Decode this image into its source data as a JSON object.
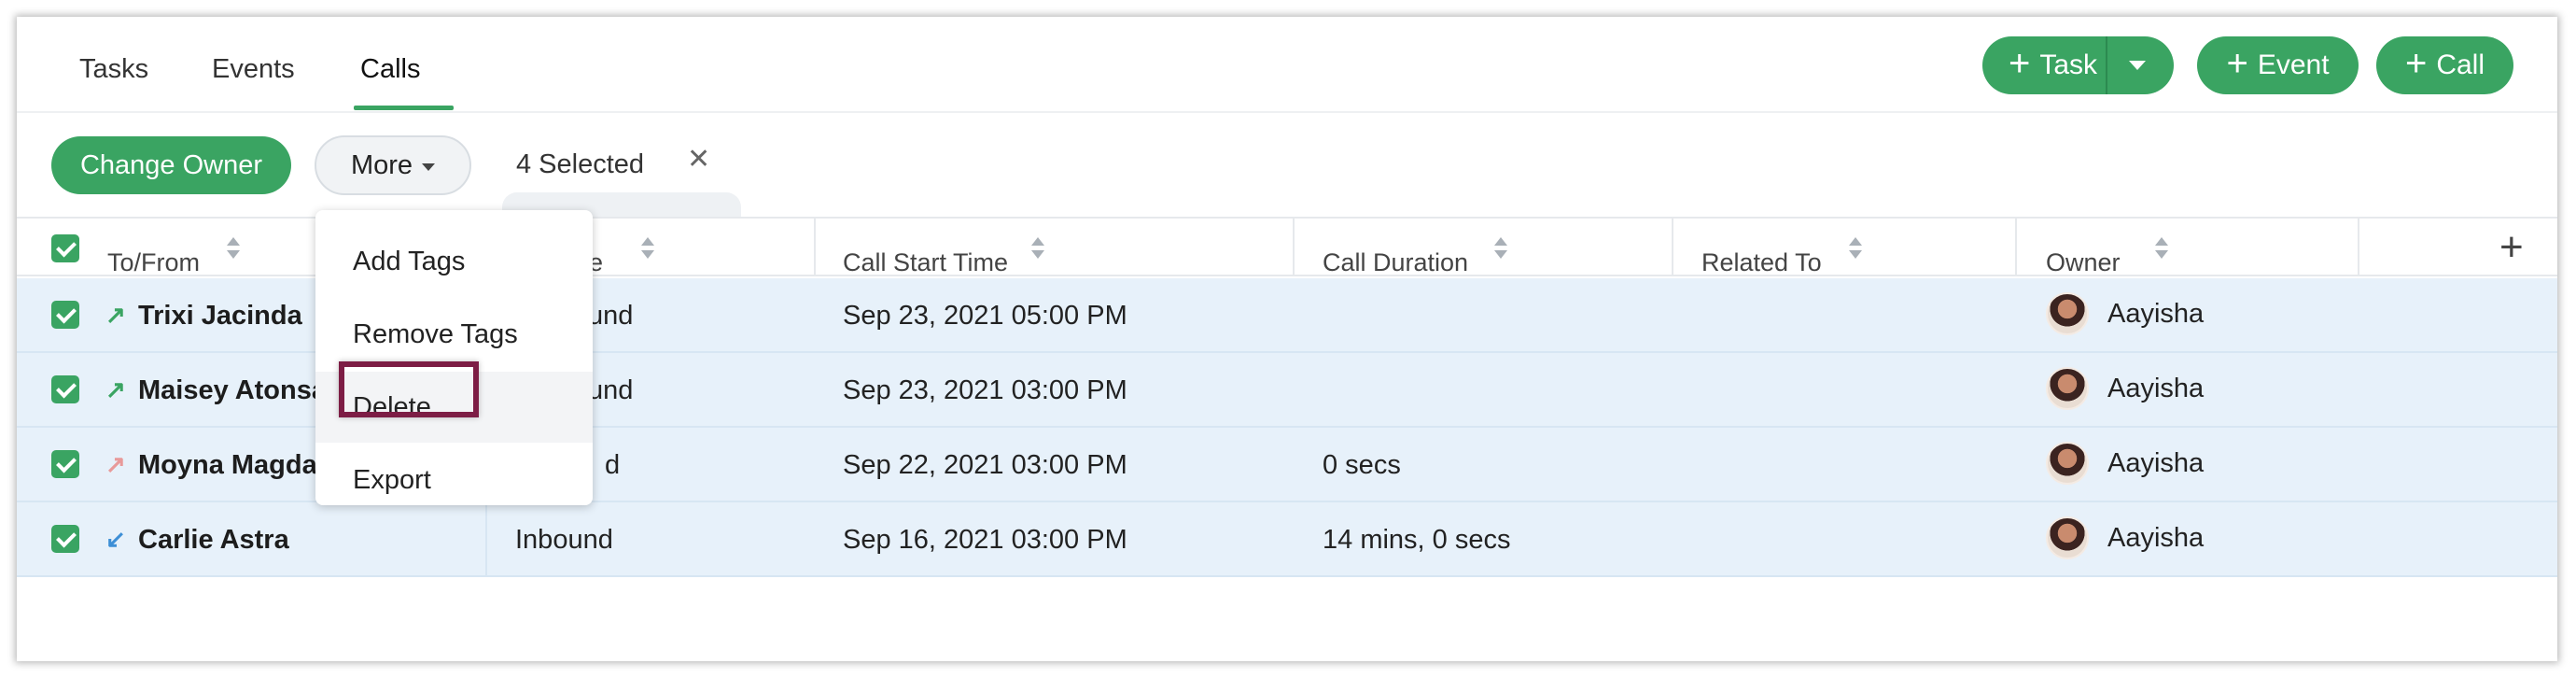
{
  "tabs": [
    {
      "label": "Tasks"
    },
    {
      "label": "Events"
    },
    {
      "label": "Calls",
      "active": true
    }
  ],
  "header_buttons": {
    "task": "Task",
    "event": "Event",
    "call": "Call",
    "plus_glyph": "+"
  },
  "toolbar": {
    "change_owner": "Change Owner",
    "more": "More",
    "selected": "4 Selected",
    "clear": "✕"
  },
  "columns": [
    "To/From",
    "Call Type",
    "Call Start Time",
    "Call Duration",
    "Related To",
    "Owner"
  ],
  "visible_column_headers": {
    "to_from": "To/From",
    "call_type_fragment": "pe",
    "call_start_time": "Call Start Time",
    "call_duration": "Call Duration",
    "related_to": "Related To",
    "owner": "Owner"
  },
  "rows": [
    {
      "direction_icon": "outgoing-arrow-icon",
      "arrow": "↗",
      "name": "Trixi Jacinda",
      "call_type": "und",
      "start": "Sep 23, 2021 05:00 PM",
      "duration": "",
      "related_to": "",
      "owner": "Aayisha",
      "checked": true
    },
    {
      "direction_icon": "outgoing-arrow-icon",
      "arrow": "↗",
      "name": "Maisey Atonsa",
      "call_type": "und",
      "start": "Sep 23, 2021 03:00 PM",
      "duration": "",
      "related_to": "",
      "owner": "Aayisha",
      "checked": true
    },
    {
      "direction_icon": "missed-arrow-icon",
      "arrow": "↗",
      "name": "Moyna Magda",
      "call_type": "d",
      "start": "Sep 22, 2021 03:00 PM",
      "duration": "0 secs",
      "related_to": "",
      "owner": "Aayisha",
      "checked": true
    },
    {
      "direction_icon": "incoming-arrow-icon",
      "arrow": "↙",
      "name": "Carlie Astra",
      "call_type": "Inbound",
      "start": "Sep 16, 2021 03:00 PM",
      "duration": "14 mins, 0 secs",
      "related_to": "",
      "owner": "Aayisha",
      "checked": true
    }
  ],
  "more_menu": {
    "items": [
      "Add Tags",
      "Remove Tags",
      "Delete",
      "Export"
    ],
    "highlighted": "Delete"
  },
  "add_column_glyph": "+",
  "colors": {
    "accent": "#3aa462",
    "row_selected": "#e7f1fa",
    "highlight_border": "#7d1d45",
    "outgoing_arrow": "#3aa462",
    "missed_arrow": "#e89a9a",
    "incoming_arrow": "#3d8fd6"
  }
}
